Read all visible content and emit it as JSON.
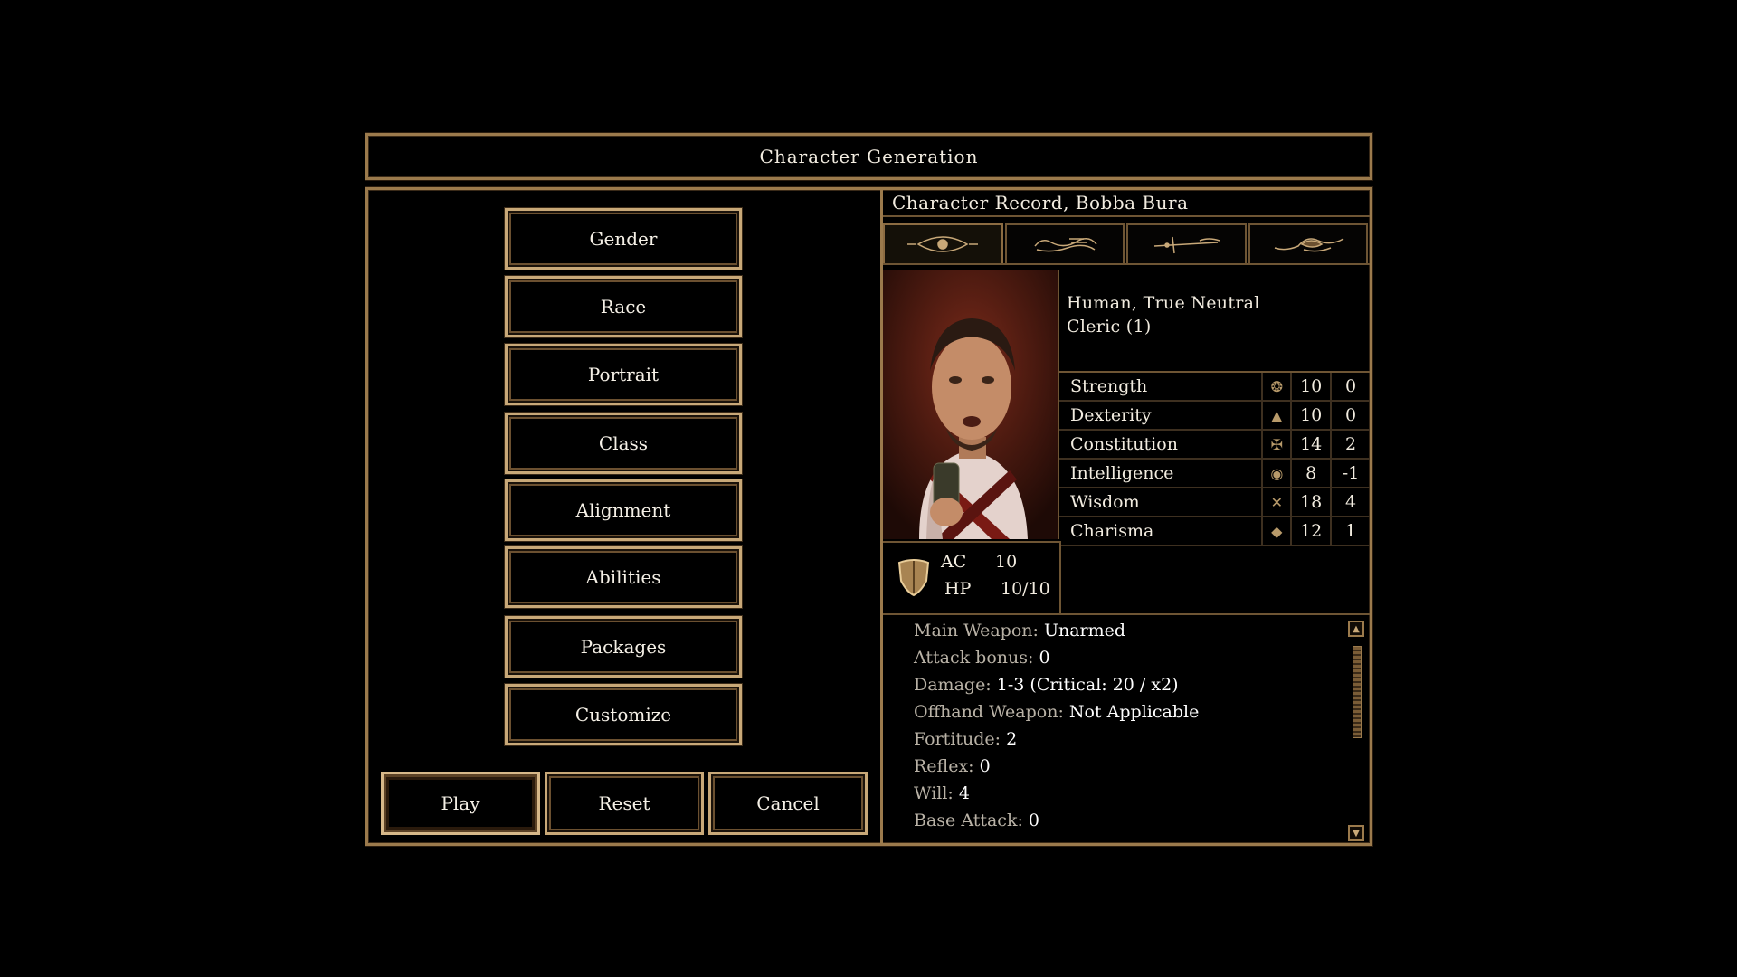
{
  "window": {
    "title": "Character Generation"
  },
  "menu": {
    "items": [
      {
        "label": "Gender"
      },
      {
        "label": "Race"
      },
      {
        "label": "Portrait"
      },
      {
        "label": "Class"
      },
      {
        "label": "Alignment"
      },
      {
        "label": "Abilities"
      },
      {
        "label": "Packages"
      },
      {
        "label": "Customize"
      }
    ]
  },
  "actions": {
    "play": "Play",
    "reset": "Reset",
    "cancel": "Cancel"
  },
  "record": {
    "title": "Character Record, Bobba Bura",
    "tabs": [
      "eye-tab-icon",
      "scroll-tab-icon",
      "sword-tab-icon",
      "wing-tab-icon"
    ],
    "description_line1": "Human, True Neutral",
    "description_line2": "Cleric (1)",
    "abilities": [
      {
        "name": "Strength",
        "value": "10",
        "mod": "0",
        "icon": "strength-icon"
      },
      {
        "name": "Dexterity",
        "value": "10",
        "mod": "0",
        "icon": "dexterity-icon"
      },
      {
        "name": "Constitution",
        "value": "14",
        "mod": "2",
        "icon": "constitution-icon"
      },
      {
        "name": "Intelligence",
        "value": "8",
        "mod": "-1",
        "icon": "intelligence-icon"
      },
      {
        "name": "Wisdom",
        "value": "18",
        "mod": "4",
        "icon": "wisdom-icon"
      },
      {
        "name": "Charisma",
        "value": "12",
        "mod": "1",
        "icon": "charisma-icon"
      }
    ],
    "ac_label": "AC",
    "ac_value": "10",
    "hp_label": "HP",
    "hp_value": "10/10",
    "stats": [
      {
        "key": "Main Weapon:",
        "value": "Unarmed"
      },
      {
        "key": "Attack bonus:",
        "value": "0"
      },
      {
        "key": "Damage:",
        "value": "1-3 (Critical: 20 / x2)"
      },
      {
        "key": "Offhand Weapon:",
        "value": "Not Applicable"
      },
      {
        "key": "Fortitude:",
        "value": "2"
      },
      {
        "key": "Reflex:",
        "value": "0"
      },
      {
        "key": "Will:",
        "value": "4"
      },
      {
        "key": "Base Attack:",
        "value": "0"
      }
    ]
  },
  "colors": {
    "gold": "#9b7a4c",
    "bright_gold": "#c8a878",
    "text": "#f2ece0"
  }
}
